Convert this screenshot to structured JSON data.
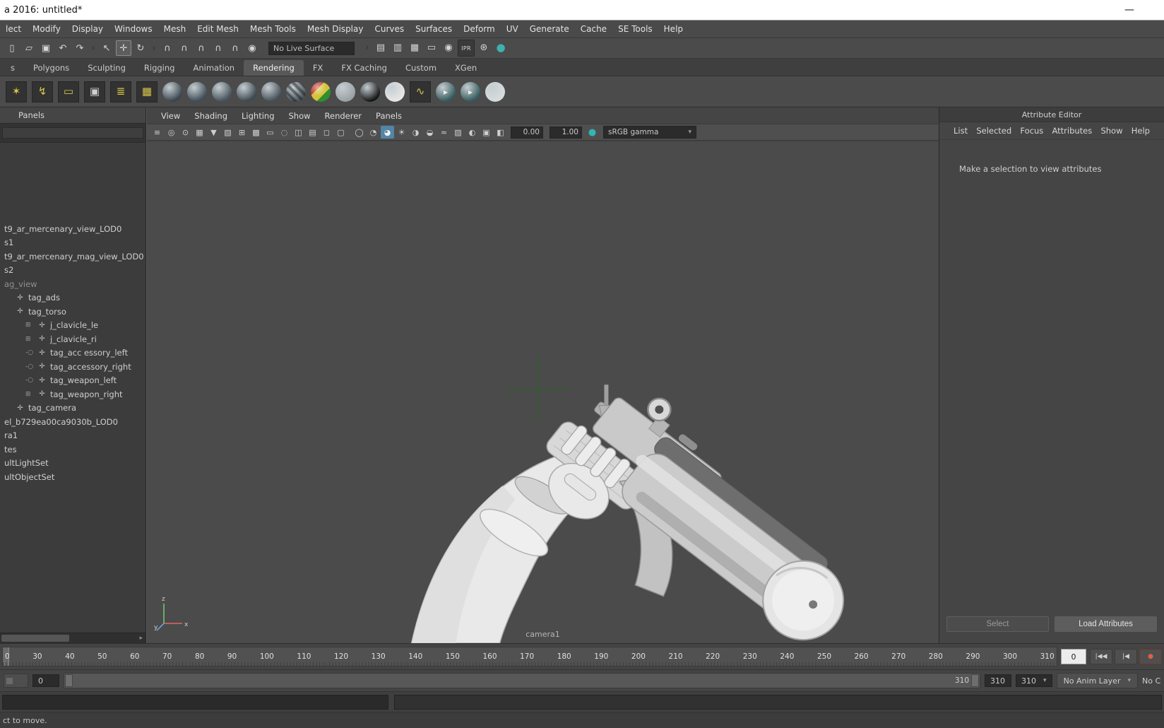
{
  "colors": {
    "accent_blue": "#5285a6",
    "shelf_yellow": "#d9c74b",
    "crosshair_green": "#2f5f2f",
    "teal": "#35b5b2"
  },
  "window": {
    "title": "a 2016: untitled*"
  },
  "glyphs": {
    "minimize": "—",
    "caret": "▾",
    "scroll_right": "▸"
  },
  "menu_bar": [
    "lect",
    "Modify",
    "Display",
    "Windows",
    "Mesh",
    "Edit Mesh",
    "Mesh Tools",
    "Mesh Display",
    "Curves",
    "Surfaces",
    "Deform",
    "UV",
    "Generate",
    "Cache",
    "SE Tools",
    "Help"
  ],
  "toolbar": {
    "live_surface": "No Live Surface",
    "icons_left": [
      {
        "name": "new-scene-icon",
        "glyph": "▯"
      },
      {
        "name": "open-scene-icon",
        "glyph": "▱"
      },
      {
        "name": "save-scene-icon",
        "glyph": "▣"
      },
      {
        "name": "undo-icon",
        "glyph": "↶"
      },
      {
        "name": "redo-icon",
        "glyph": "↷"
      },
      {
        "name": "group-separator-icon",
        "glyph": "›",
        "cls": "sep"
      },
      {
        "name": "select-tool-icon",
        "glyph": "↖"
      },
      {
        "name": "move-tool-icon",
        "glyph": "✛",
        "cls": "active"
      },
      {
        "name": "rotate-tool-icon",
        "glyph": "↻"
      },
      {
        "name": "group-separator-icon",
        "glyph": "›",
        "cls": "sep"
      },
      {
        "name": "snap-to-grid-icon",
        "glyph": "∩"
      },
      {
        "name": "snap-to-curve-icon",
        "glyph": "∩"
      },
      {
        "name": "snap-to-point-icon",
        "glyph": "∩"
      },
      {
        "name": "snap-to-plane-icon",
        "glyph": "∩"
      },
      {
        "name": "snap-to-view-icon",
        "glyph": "∩"
      },
      {
        "name": "make-live-icon",
        "glyph": "◉"
      }
    ],
    "icons_right": [
      {
        "name": "group-separator-icon",
        "glyph": "›",
        "cls": "sep"
      },
      {
        "name": "input-connections-icon",
        "glyph": "▤"
      },
      {
        "name": "output-connections-icon",
        "glyph": "▥"
      },
      {
        "name": "construction-history-icon",
        "glyph": "▦"
      },
      {
        "name": "open-render-view-icon",
        "glyph": "▭"
      },
      {
        "name": "render-current-frame-icon",
        "glyph": "◉"
      },
      {
        "name": "ipr-render-icon",
        "glyph": "IPR",
        "cls": "txt"
      },
      {
        "name": "render-settings-icon",
        "glyph": "⊛"
      },
      {
        "name": "color-management-icon",
        "glyph": "●",
        "cls": "teal"
      }
    ]
  },
  "shelf": {
    "tabs": [
      {
        "label": "s"
      },
      {
        "label": "Polygons"
      },
      {
        "label": "Sculpting"
      },
      {
        "label": "Rigging"
      },
      {
        "label": "Animation"
      },
      {
        "label": "Rendering",
        "cls": "active"
      },
      {
        "label": "FX"
      },
      {
        "label": "FX Caching"
      },
      {
        "label": "Custom"
      },
      {
        "label": "XGen"
      }
    ],
    "icons": [
      {
        "name": "paint-effects-icon",
        "glyph": "✶",
        "cls": "sq"
      },
      {
        "name": "lightning-shader-icon",
        "glyph": "↯",
        "cls": "sq"
      },
      {
        "name": "area-light-icon",
        "glyph": "▭",
        "cls": "sq"
      },
      {
        "name": "camera-icon",
        "glyph": "▣",
        "cls": "sq",
        "color": "#cfcfcf"
      },
      {
        "name": "render-layers-icon",
        "glyph": "≣",
        "cls": "sq"
      },
      {
        "name": "uv-texture-icon",
        "glyph": "▦",
        "cls": "sq"
      },
      {
        "name": "anisotropic-material-icon",
        "cls": "ball",
        "color": "#39454d"
      },
      {
        "name": "blinn-material-icon",
        "cls": "ball",
        "color": "#404d56"
      },
      {
        "name": "lambert-material-icon",
        "cls": "ball",
        "color": "#46535b"
      },
      {
        "name": "phong-material-icon",
        "cls": "ball",
        "color": "#3d4951"
      },
      {
        "name": "phong-e-material-icon",
        "cls": "ball",
        "color": "#444f58"
      },
      {
        "name": "ramp-shader-icon",
        "cls": "ball stripe",
        "color": "#49555d"
      },
      {
        "name": "shading-map-icon",
        "cls": "ball rgb"
      },
      {
        "name": "surface-shader-icon",
        "cls": "ball",
        "color": "#9aa1a5"
      },
      {
        "name": "use-background-icon",
        "cls": "ball",
        "color": "#141618"
      },
      {
        "name": "ambient-material-icon",
        "cls": "ball",
        "color": "#e6e6e6"
      },
      {
        "name": "hypershade-icon",
        "glyph": "∿",
        "cls": "sq"
      },
      {
        "name": "render-view-icon",
        "glyph": "▸",
        "cls": "ball",
        "color": "#34595c"
      },
      {
        "name": "ipr-render-shelf-icon",
        "glyph": "▸",
        "cls": "ball",
        "color": "#34595c"
      },
      {
        "name": "render-frame-icon",
        "cls": "ball",
        "color": "#d7dbdd"
      }
    ]
  },
  "outliner": {
    "menu_label": "Panels",
    "items": [
      {
        "label": "t9_ar_mercenary_view_LOD0",
        "indent": 0
      },
      {
        "label": "s1",
        "indent": 0
      },
      {
        "label": "t9_ar_mercenary_mag_view_LOD0",
        "indent": 0
      },
      {
        "label": "s2",
        "indent": 0
      },
      {
        "label": "ag_view",
        "indent": 0,
        "cls": "dim"
      },
      {
        "label": "tag_ads",
        "indent": 1,
        "icon": "✛"
      },
      {
        "label": "tag_torso",
        "indent": 1,
        "icon": "✛"
      },
      {
        "label": "j_clavicle_le",
        "indent": 2,
        "prefix": "⊞",
        "icon": "✛"
      },
      {
        "label": "j_clavicle_ri",
        "indent": 2,
        "prefix": "⊞",
        "icon": "✛"
      },
      {
        "label": "tag_acc essory_left",
        "indent": 2,
        "prefix": "-○",
        "icon": "✛"
      },
      {
        "label": "tag_accessory_right",
        "indent": 2,
        "prefix": "-○",
        "icon": "✛"
      },
      {
        "label": "tag_weapon_left",
        "indent": 2,
        "prefix": "-○",
        "icon": "✛"
      },
      {
        "label": "tag_weapon_right",
        "indent": 2,
        "prefix": "⊞",
        "icon": "✛"
      },
      {
        "label": "tag_camera",
        "indent": 1,
        "icon": "✛"
      },
      {
        "label": "el_b729ea00ca9030b_LOD0",
        "indent": 0
      },
      {
        "label": "ra1",
        "indent": 0
      },
      {
        "label": "tes",
        "indent": 0
      },
      {
        "label": "ultLightSet",
        "indent": 0
      },
      {
        "label": "ultObjectSet",
        "indent": 0
      }
    ]
  },
  "viewport": {
    "menus": [
      "View",
      "Shading",
      "Lighting",
      "Show",
      "Renderer",
      "Panels"
    ],
    "toolbar": {
      "icons_a": [
        {
          "name": "panel-layout-icon",
          "glyph": "≡"
        },
        {
          "name": "select-camera-icon",
          "glyph": "◎"
        },
        {
          "name": "lock-camera-icon",
          "glyph": "⊙"
        },
        {
          "name": "camera-attributes-icon",
          "glyph": "▦"
        },
        {
          "name": "bookmarks-icon",
          "glyph": "▼"
        },
        {
          "name": "image-plane-icon",
          "glyph": "▧"
        },
        {
          "name": "pan-zoom-icon",
          "glyph": "⊞"
        },
        {
          "name": "grid-icon",
          "glyph": "▩"
        },
        {
          "name": "film-gate-icon",
          "glyph": "▭"
        },
        {
          "name": "resolution-gate-icon",
          "glyph": "◌"
        },
        {
          "name": "gate-mask-icon",
          "glyph": "◫"
        },
        {
          "name": "field-chart-icon",
          "glyph": "▤"
        },
        {
          "name": "safe-action-icon",
          "glyph": "◻"
        },
        {
          "name": "safe-title-icon",
          "glyph": "▢"
        }
      ],
      "icons_b": [
        {
          "name": "wireframe-mode-icon",
          "glyph": "◯"
        },
        {
          "name": "shaded-mode-icon",
          "glyph": "◔"
        },
        {
          "name": "textured-mode-icon",
          "glyph": "◕",
          "cls": "active"
        },
        {
          "name": "use-all-lights-icon",
          "glyph": "☀"
        },
        {
          "name": "shadows-icon",
          "glyph": "◑"
        },
        {
          "name": "occlusion-icon",
          "glyph": "◒"
        },
        {
          "name": "motion-blur-icon",
          "glyph": "≈"
        },
        {
          "name": "multisampling-icon",
          "glyph": "▨"
        },
        {
          "name": "depth-of-field-icon",
          "glyph": "◐"
        },
        {
          "name": "isolate-select-icon",
          "glyph": "▣"
        },
        {
          "name": "xray-icon",
          "glyph": "◧"
        }
      ],
      "exposure_value": "0.00",
      "gamma_value": "1.00",
      "icons_c": [
        {
          "name": "color-management-icon",
          "glyph": "●",
          "cls": "teal"
        }
      ],
      "color_space": "sRGB gamma"
    },
    "camera_label": "camera1",
    "axis": {
      "up": "z",
      "right": "x",
      "depth": "y"
    }
  },
  "attribute_editor": {
    "title": "Attribute Editor",
    "menus": [
      "List",
      "Selected",
      "Focus",
      "Attributes",
      "Show",
      "Help"
    ],
    "message": "Make a selection to view attributes",
    "select_button": "Select",
    "load_button": "Load Attributes"
  },
  "timeline": {
    "labels": [
      "0",
      "30",
      "40",
      "50",
      "60",
      "70",
      "80",
      "90",
      "100",
      "110",
      "120",
      "130",
      "140",
      "150",
      "160",
      "170",
      "180",
      "190",
      "200",
      "210",
      "220",
      "230",
      "240",
      "250",
      "260",
      "270",
      "280",
      "290",
      "300",
      "310"
    ],
    "current_frame": "0",
    "playback": [
      {
        "name": "go-to-start-button",
        "glyph": "|◀◀"
      },
      {
        "name": "step-back-frame-button",
        "glyph": "|◀"
      },
      {
        "name": "auto-key-button",
        "glyph": "●",
        "cls": "red"
      }
    ]
  },
  "range_slider": {
    "start": "0",
    "range_end_label": "310",
    "playback_end": "310",
    "animation_end": "310",
    "anim_layer": "No Anim Layer",
    "character_set": "No C"
  },
  "help_line": "ct to move."
}
